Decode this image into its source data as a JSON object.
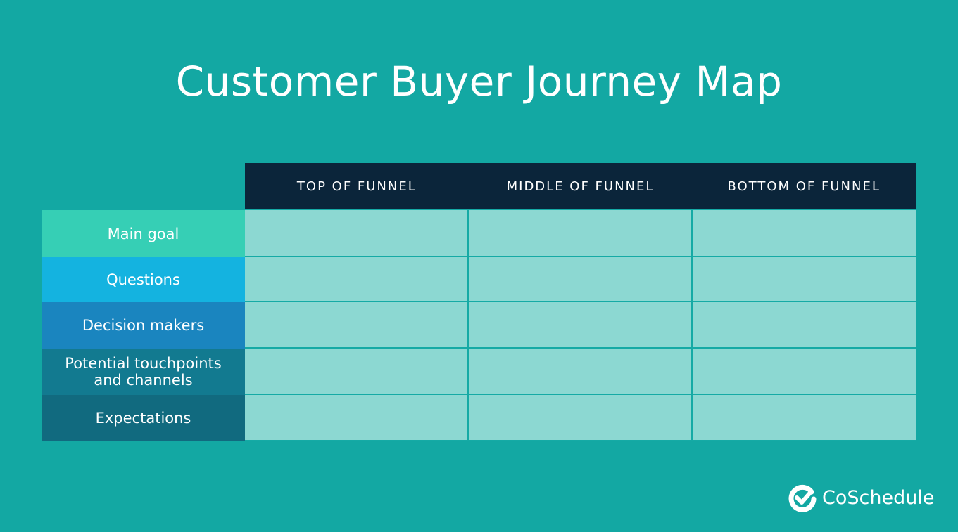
{
  "title": "Customer Buyer Journey Map",
  "columns": [
    {
      "label": "TOP OF FUNNEL"
    },
    {
      "label": "MIDDLE OF FUNNEL"
    },
    {
      "label": "BOTTOM OF FUNNEL"
    }
  ],
  "rows": [
    {
      "label": "Main goal",
      "color": "#36cfb5"
    },
    {
      "label": "Questions",
      "color": "#14b3e0"
    },
    {
      "label": "Decision makers",
      "color": "#1a85bf"
    },
    {
      "label": "Potential touchpoints and channels",
      "color": "#127a90"
    },
    {
      "label": "Expectations",
      "color": "#116a7f"
    }
  ],
  "brand": {
    "name": "CoSchedule",
    "icon": "check-circle-icon"
  },
  "colors": {
    "background": "#13a8a3",
    "header": "#0b253a",
    "cell": "#8cd8d2"
  }
}
